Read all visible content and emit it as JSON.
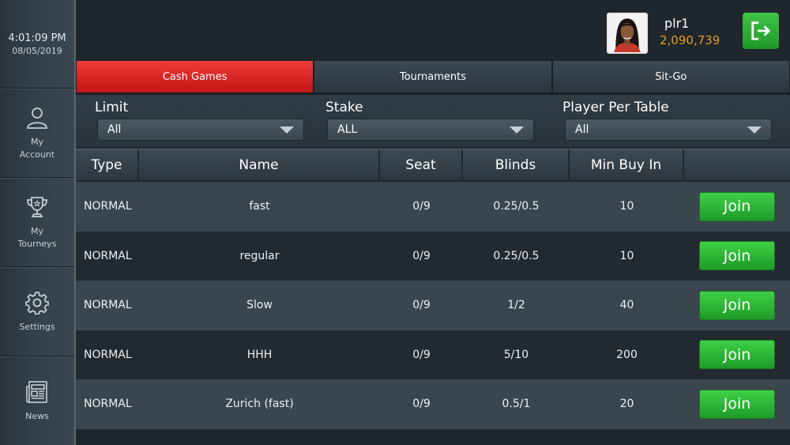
{
  "clock": {
    "time": "4:01:09 PM",
    "date": "08/05/2019"
  },
  "sidebar": {
    "items": [
      {
        "label_line1": "My",
        "label_line2": "Account",
        "icon": "user-icon"
      },
      {
        "label_line1": "My",
        "label_line2": "Tourneys",
        "icon": "trophy-icon"
      },
      {
        "label_line1": "Settings",
        "label_line2": "",
        "icon": "gear-icon"
      },
      {
        "label_line1": "News",
        "label_line2": "",
        "icon": "newspaper-icon"
      }
    ]
  },
  "player": {
    "name": "plr1",
    "chips": "2,090,739"
  },
  "tabs": [
    {
      "label": "Cash Games",
      "active": true
    },
    {
      "label": "Tournaments",
      "active": false
    },
    {
      "label": "Sit-Go",
      "active": false
    }
  ],
  "filters": {
    "limit": {
      "label": "Limit",
      "value": "All"
    },
    "stake": {
      "label": "Stake",
      "value": "ALL"
    },
    "players": {
      "label": "Player Per Table",
      "value": "All"
    }
  },
  "table": {
    "headers": {
      "type": "Type",
      "name": "Name",
      "seat": "Seat",
      "blinds": "Blinds",
      "min_buy_in": "Min Buy In"
    },
    "join_label": "Join",
    "rows": [
      {
        "type": "NORMAL",
        "name": "fast",
        "seat": "0/9",
        "blinds": "0.25/0.5",
        "min_buy_in": "10"
      },
      {
        "type": "NORMAL",
        "name": "regular",
        "seat": "0/9",
        "blinds": "0.25/0.5",
        "min_buy_in": "10"
      },
      {
        "type": "NORMAL",
        "name": "Slow",
        "seat": "0/9",
        "blinds": "1/2",
        "min_buy_in": "40"
      },
      {
        "type": "NORMAL",
        "name": "HHH",
        "seat": "0/9",
        "blinds": "5/10",
        "min_buy_in": "200"
      },
      {
        "type": "NORMAL",
        "name": "Zurich (fast)",
        "seat": "0/9",
        "blinds": "0.5/1",
        "min_buy_in": "20"
      }
    ]
  },
  "colors": {
    "active_tab": "#e02828",
    "join_button": "#2fb838",
    "chips": "#e39a2c"
  }
}
